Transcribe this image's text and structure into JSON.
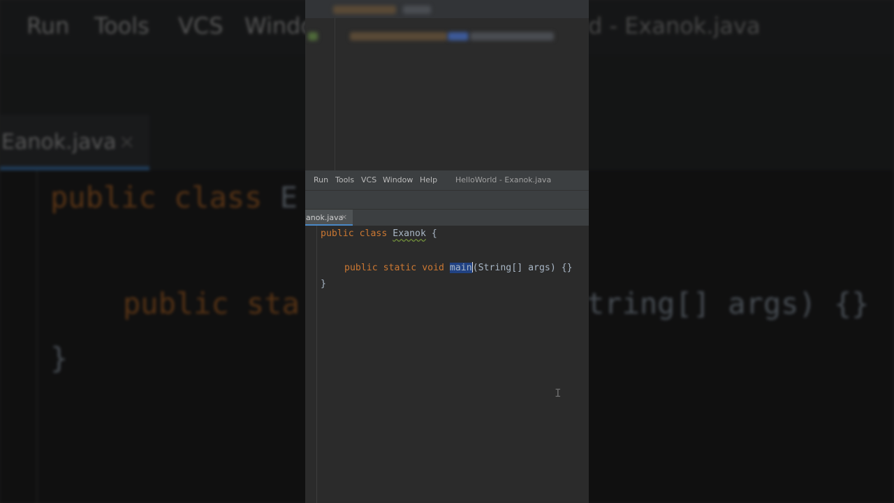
{
  "window": {
    "title": "HelloWorld - Exanok.java",
    "bg_title_fragment": "d - Exanok.java"
  },
  "menu": {
    "items": [
      "Run",
      "Tools",
      "VCS",
      "Window",
      "Help"
    ],
    "bg_partial_window": "Windo"
  },
  "tabs": {
    "active_label": "anok.java",
    "bg_active_label": "anok.java",
    "close_glyph": "×"
  },
  "code": {
    "line1": {
      "kw1": "public",
      "kw2": "class",
      "name": "Exanok",
      "brace": "{"
    },
    "line2": {
      "kw1": "public",
      "kw2": "static",
      "kw3": "void",
      "selected": "main",
      "params": "(String[] args) {}"
    },
    "line3": {
      "brace": "}"
    },
    "bg_line1_fragment": "E",
    "bg_line2_left": "public sta",
    "bg_line2_right": "tring[] args) {}"
  },
  "colors": {
    "keyword": "#cc7832",
    "text": "#a9b7c6",
    "selection": "#214283",
    "tab_accent": "#4a88c7"
  }
}
